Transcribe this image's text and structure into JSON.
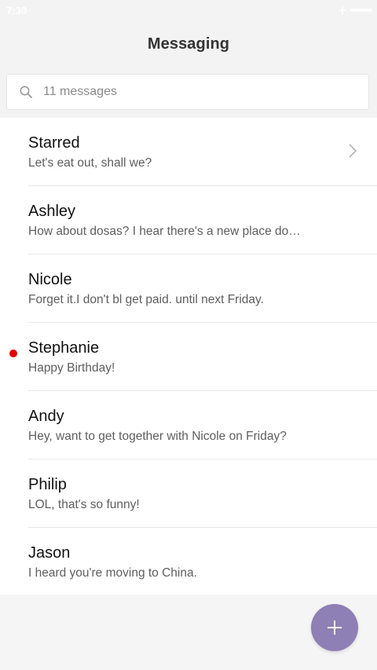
{
  "status_bar": {
    "time": "7:30"
  },
  "header": {
    "title": "Messaging"
  },
  "search": {
    "placeholder": "11 messages",
    "value": ""
  },
  "conversations": [
    {
      "name": "Starred",
      "preview": "Let's eat out, shall we?",
      "unread": false,
      "has_chevron": true
    },
    {
      "name": "Ashley",
      "preview": "How about dosas? I hear there's a new place do…",
      "unread": false,
      "has_chevron": false
    },
    {
      "name": "Nicole",
      "preview": "Forget it.I don't bl get paid. until next Friday.",
      "unread": false,
      "has_chevron": false
    },
    {
      "name": "Stephanie",
      "preview": "Happy Birthday!",
      "unread": true,
      "has_chevron": false
    },
    {
      "name": "Andy",
      "preview": "Hey, want to get together with Nicole on Friday?",
      "unread": false,
      "has_chevron": false
    },
    {
      "name": "Philip",
      "preview": "LOL, that's so funny!",
      "unread": false,
      "has_chevron": false
    },
    {
      "name": "Jason",
      "preview": "I heard you're moving to China.",
      "unread": false,
      "has_chevron": false
    }
  ],
  "icons": {
    "search": "search-icon",
    "chevron": "chevron-right-icon",
    "compose": "plus-icon",
    "download": "download-icon"
  },
  "colors": {
    "accent": "#8e7fb5",
    "unread_dot": "#e00000",
    "header_bg": "#f3f3f3"
  }
}
